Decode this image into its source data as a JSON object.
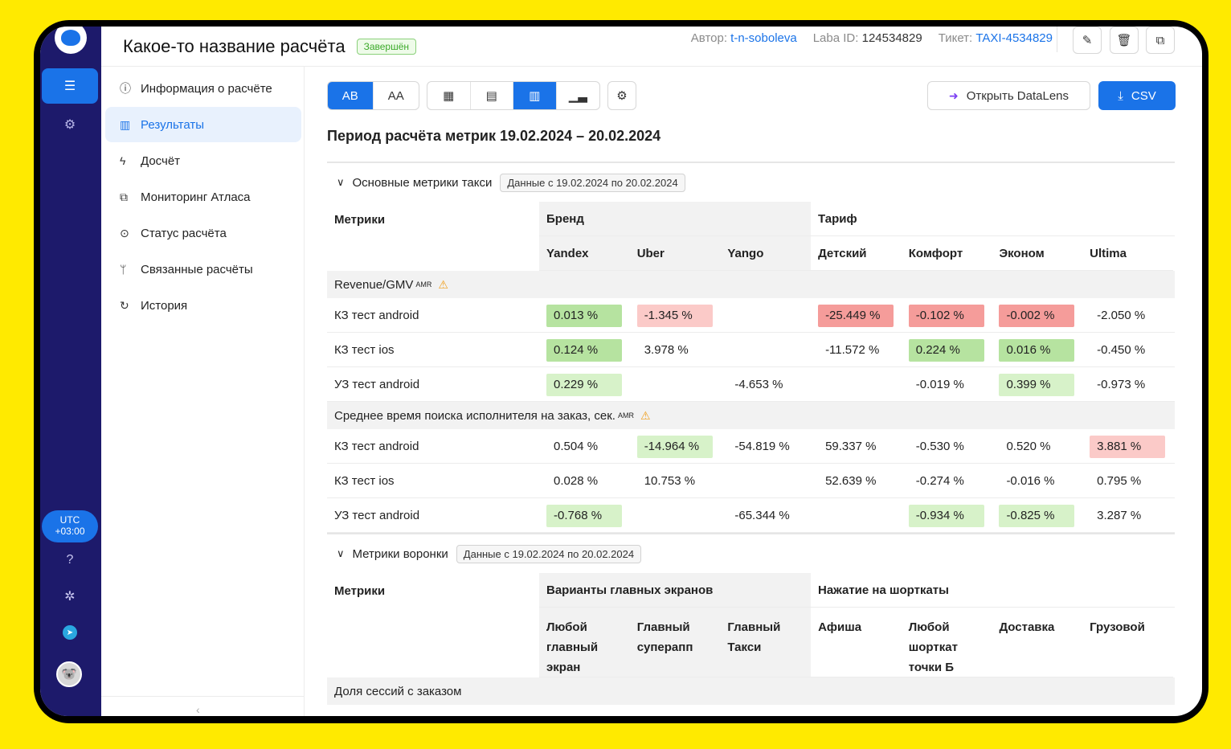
{
  "header": {
    "title": "Какое-то название расчёта",
    "status": "Завершён",
    "author_label": "Автор:",
    "author": "t-n-soboleva",
    "laba_label": "Laba ID:",
    "laba_id": "124534829",
    "ticket_label": "Тикет:",
    "ticket": "TAXI-4534829"
  },
  "rail": {
    "utc_line1": "UTC",
    "utc_line2": "+03:00"
  },
  "nav": {
    "items": [
      {
        "label": "Информация о расчёте",
        "icon": "ⓘ"
      },
      {
        "label": "Результаты",
        "icon": "▥"
      },
      {
        "label": "Досчёт",
        "icon": "ϟ"
      },
      {
        "label": "Мониторинг Атласа",
        "icon": "⧉"
      },
      {
        "label": "Статус расчёта",
        "icon": "⊙"
      },
      {
        "label": "Связанные расчёты",
        "icon": "ᛘ"
      },
      {
        "label": "История",
        "icon": "↻"
      }
    ],
    "collapse": "‹"
  },
  "toolbar": {
    "ab": "AB",
    "aa": "AA",
    "datalens": "Открыть DataLens",
    "csv": "CSV"
  },
  "period": "Период расчёта метрик 19.02.2024 – 20.02.2024",
  "section1": {
    "title": "Основные метрики такси",
    "chip": "Данные с 19.02.2024 по 20.02.2024",
    "metrics_header": "Метрики",
    "group1": "Бренд",
    "group2": "Тариф",
    "columns": [
      "Yandex",
      "Uber",
      "Yango",
      "Детский",
      "Комфорт",
      "Эконом",
      "Ultima"
    ],
    "blocks": [
      {
        "name": "Revenue/GMV",
        "sup": "AMR",
        "rows": [
          {
            "label": "КЗ тест android",
            "cells": [
              {
                "v": "0.013 %",
                "c": "gr"
              },
              {
                "v": "-1.345 %",
                "c": "lrd"
              },
              {
                "v": "",
                "c": ""
              },
              {
                "v": "-25.449 %",
                "c": "rd"
              },
              {
                "v": "-0.102 %",
                "c": "rd"
              },
              {
                "v": "-0.002 %",
                "c": "rd"
              },
              {
                "v": "-2.050 %",
                "c": ""
              }
            ]
          },
          {
            "label": "КЗ тест ios",
            "cells": [
              {
                "v": "0.124 %",
                "c": "gr"
              },
              {
                "v": "3.978 %",
                "c": ""
              },
              {
                "v": "",
                "c": ""
              },
              {
                "v": "-11.572 %",
                "c": ""
              },
              {
                "v": "0.224 %",
                "c": "gr"
              },
              {
                "v": "0.016 %",
                "c": "gr"
              },
              {
                "v": "-0.450 %",
                "c": ""
              }
            ]
          },
          {
            "label": "УЗ тест android",
            "cells": [
              {
                "v": "0.229 %",
                "c": "lgr"
              },
              {
                "v": "",
                "c": ""
              },
              {
                "v": "-4.653 %",
                "c": ""
              },
              {
                "v": "",
                "c": ""
              },
              {
                "v": "-0.019 %",
                "c": ""
              },
              {
                "v": "0.399 %",
                "c": "lgr"
              },
              {
                "v": "-0.973 %",
                "c": ""
              }
            ]
          }
        ]
      },
      {
        "name": "Среднее время поиска исполнителя на заказ, сек.",
        "sup": "AMR",
        "rows": [
          {
            "label": "КЗ тест android",
            "cells": [
              {
                "v": "0.504 %",
                "c": ""
              },
              {
                "v": "-14.964 %",
                "c": "lgr"
              },
              {
                "v": "-54.819 %",
                "c": ""
              },
              {
                "v": "59.337 %",
                "c": ""
              },
              {
                "v": "-0.530 %",
                "c": ""
              },
              {
                "v": "0.520 %",
                "c": ""
              },
              {
                "v": "3.881 %",
                "c": "lrd"
              }
            ]
          },
          {
            "label": "КЗ тест ios",
            "cells": [
              {
                "v": "0.028 %",
                "c": ""
              },
              {
                "v": "10.753 %",
                "c": ""
              },
              {
                "v": "",
                "c": ""
              },
              {
                "v": "52.639 %",
                "c": ""
              },
              {
                "v": "-0.274 %",
                "c": ""
              },
              {
                "v": "-0.016 %",
                "c": ""
              },
              {
                "v": "0.795 %",
                "c": ""
              }
            ]
          },
          {
            "label": "УЗ тест android",
            "cells": [
              {
                "v": "-0.768 %",
                "c": "lgr"
              },
              {
                "v": "",
                "c": ""
              },
              {
                "v": "-65.344 %",
                "c": ""
              },
              {
                "v": "",
                "c": ""
              },
              {
                "v": "-0.934 %",
                "c": "lgr"
              },
              {
                "v": "-0.825 %",
                "c": "lgr"
              },
              {
                "v": "3.287 %",
                "c": ""
              }
            ]
          }
        ]
      }
    ]
  },
  "section2": {
    "title": "Метрики воронки",
    "chip": "Данные с 19.02.2024 по 20.02.2024",
    "metrics_header": "Метрики",
    "group1": "Варианты главных экранов",
    "group2": "Нажатие на шорткаты",
    "columns": [
      "Любой главный экран",
      "Главный суперапп",
      "Главный Такси",
      "Афиша",
      "Любой шорткат точки Б",
      "Доставка",
      "Грузовой"
    ],
    "block1": "Доля сессий с заказом"
  }
}
